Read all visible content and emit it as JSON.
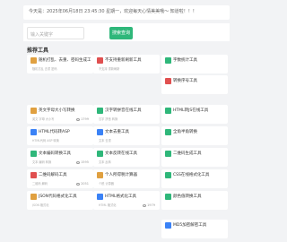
{
  "notice": "今天是：2025年06月18日 23:45:30 星期一，欢迎每天心情美美哦～ 知道啦！！！",
  "search": {
    "placeholder": "输入关键字",
    "button": "搜索查询"
  },
  "section_title": "推荐工具",
  "cards": [
    {
      "title": "随机打乱、去重、密码生成工具",
      "meta": "随机打乱 去重 密码",
      "views": "",
      "color": "#e0a040",
      "icon": "lock-icon"
    },
    {
      "title": "不支持重新刷新工具",
      "meta": "不支持 重新刷新",
      "views": "",
      "color": "#e05050",
      "icon": "refresh-icon"
    },
    {
      "title": "字数统计工具",
      "meta": "",
      "views": "",
      "color": "#2fb77a",
      "icon": "count-icon"
    },
    {
      "title": "转换序号工具",
      "meta": "",
      "views": "",
      "color": "#e05050",
      "icon": "number-icon"
    },
    {
      "title": "英文字母大小写转换",
      "meta": "英文 字母 大小写",
      "views": "1799",
      "color": "#e0a040",
      "icon": "text-icon"
    },
    {
      "title": "汉字转拼音在线工具",
      "meta": "汉字 拼音 转换",
      "views": "",
      "color": "#2fb77a",
      "icon": "pinyin-icon"
    },
    {
      "title": "HTML转JS在线工具",
      "meta": "",
      "views": "",
      "color": "#2fb77a",
      "icon": "code-icon"
    },
    {
      "title": "HTML代码转ASP",
      "meta": "HTML代码 ASP 转换",
      "views": "",
      "color": "#3b82f6",
      "icon": "asp-icon"
    },
    {
      "title": "文本去重工具",
      "meta": "文本 去重",
      "views": "",
      "color": "#3b82f6",
      "icon": "dedupe-icon"
    },
    {
      "title": "全角半角转换",
      "meta": "",
      "views": "",
      "color": "#2fb77a",
      "icon": "width-icon"
    },
    {
      "title": "文本编码转换工具",
      "meta": "文本 编码 转换",
      "views": "1595",
      "color": "#2fb77a",
      "icon": "encode-icon"
    },
    {
      "title": "文本反转在线工具",
      "meta": "文本 反转",
      "views": "",
      "color": "#2fb77a",
      "icon": "reverse-icon"
    },
    {
      "title": "二维码生成工具",
      "meta": "",
      "views": "",
      "color": "#2fb77a",
      "icon": "qrcode-icon"
    },
    {
      "title": "二维码解码工具",
      "meta": "二维码 解码",
      "views": "2051",
      "color": "#e05050",
      "icon": "decode-icon"
    },
    {
      "title": "个人所得税计算器",
      "meta": "个税 计算器",
      "views": "",
      "color": "#e0a040",
      "icon": "tax-icon"
    },
    {
      "title": "CSS在线格式化工具",
      "meta": "",
      "views": "",
      "color": "#2fb77a",
      "icon": "css-icon"
    },
    {
      "title": "JSON代码格式化工具",
      "meta": "JSON 格式化",
      "views": "",
      "color": "#e0a040",
      "icon": "json-icon"
    },
    {
      "title": "HTML格式化工具",
      "meta": "HTML 格式化",
      "views": "1979",
      "color": "#3b82f6",
      "icon": "html-icon"
    },
    {
      "title": "颜色值转换工具",
      "meta": "",
      "views": "",
      "color": "#2fb77a",
      "icon": "color-icon"
    },
    {
      "title": "MD5加密解密工具",
      "meta": "",
      "views": "",
      "color": "#3b82f6",
      "icon": "md5-icon"
    }
  ]
}
